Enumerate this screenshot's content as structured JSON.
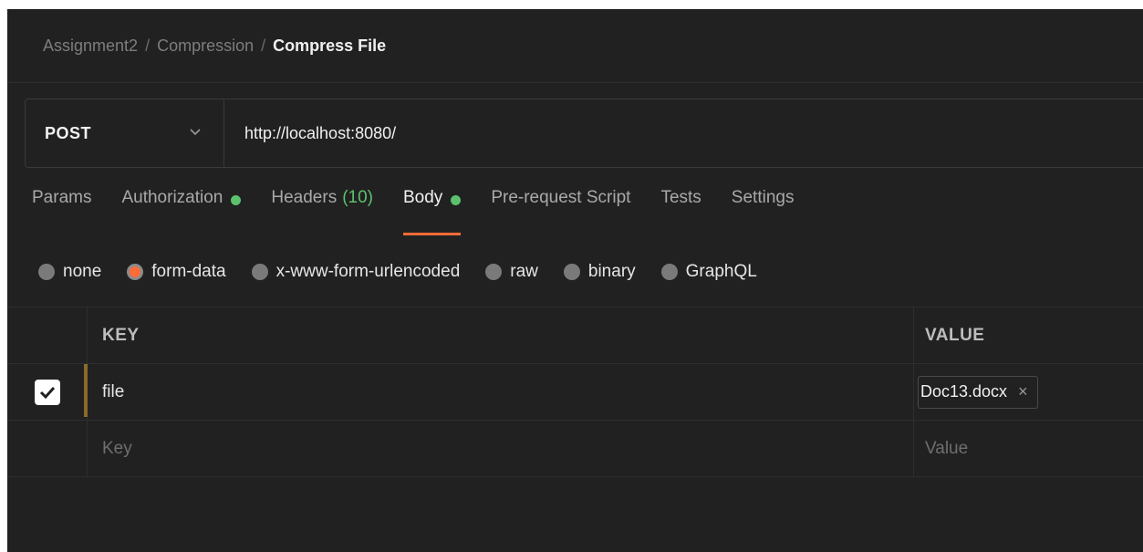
{
  "breadcrumb": {
    "items": [
      "Assignment2",
      "Compression"
    ],
    "current": "Compress File",
    "separator": "/"
  },
  "request": {
    "method": "POST",
    "url": "http://localhost:8080/"
  },
  "tabs": [
    {
      "label": "Params",
      "active": false
    },
    {
      "label": "Authorization",
      "active": false,
      "dot": true
    },
    {
      "label": "Headers",
      "count": "(10)",
      "active": false
    },
    {
      "label": "Body",
      "active": true,
      "dot": true
    },
    {
      "label": "Pre-request Script",
      "active": false
    },
    {
      "label": "Tests",
      "active": false
    },
    {
      "label": "Settings",
      "active": false
    }
  ],
  "body_types": [
    {
      "label": "none",
      "selected": false
    },
    {
      "label": "form-data",
      "selected": true
    },
    {
      "label": "x-www-form-urlencoded",
      "selected": false
    },
    {
      "label": "raw",
      "selected": false
    },
    {
      "label": "binary",
      "selected": false
    },
    {
      "label": "GraphQL",
      "selected": false
    }
  ],
  "table": {
    "headers": {
      "key": "KEY",
      "value": "VALUE"
    },
    "rows": [
      {
        "checked": true,
        "key": "file",
        "value": "Doc13.docx",
        "value_remove": "×"
      }
    ],
    "new_row": {
      "key_placeholder": "Key",
      "value_placeholder": "Value"
    }
  },
  "colors": {
    "accent": "#ff6c37",
    "status_green": "#5cc16d",
    "background": "#212121"
  }
}
